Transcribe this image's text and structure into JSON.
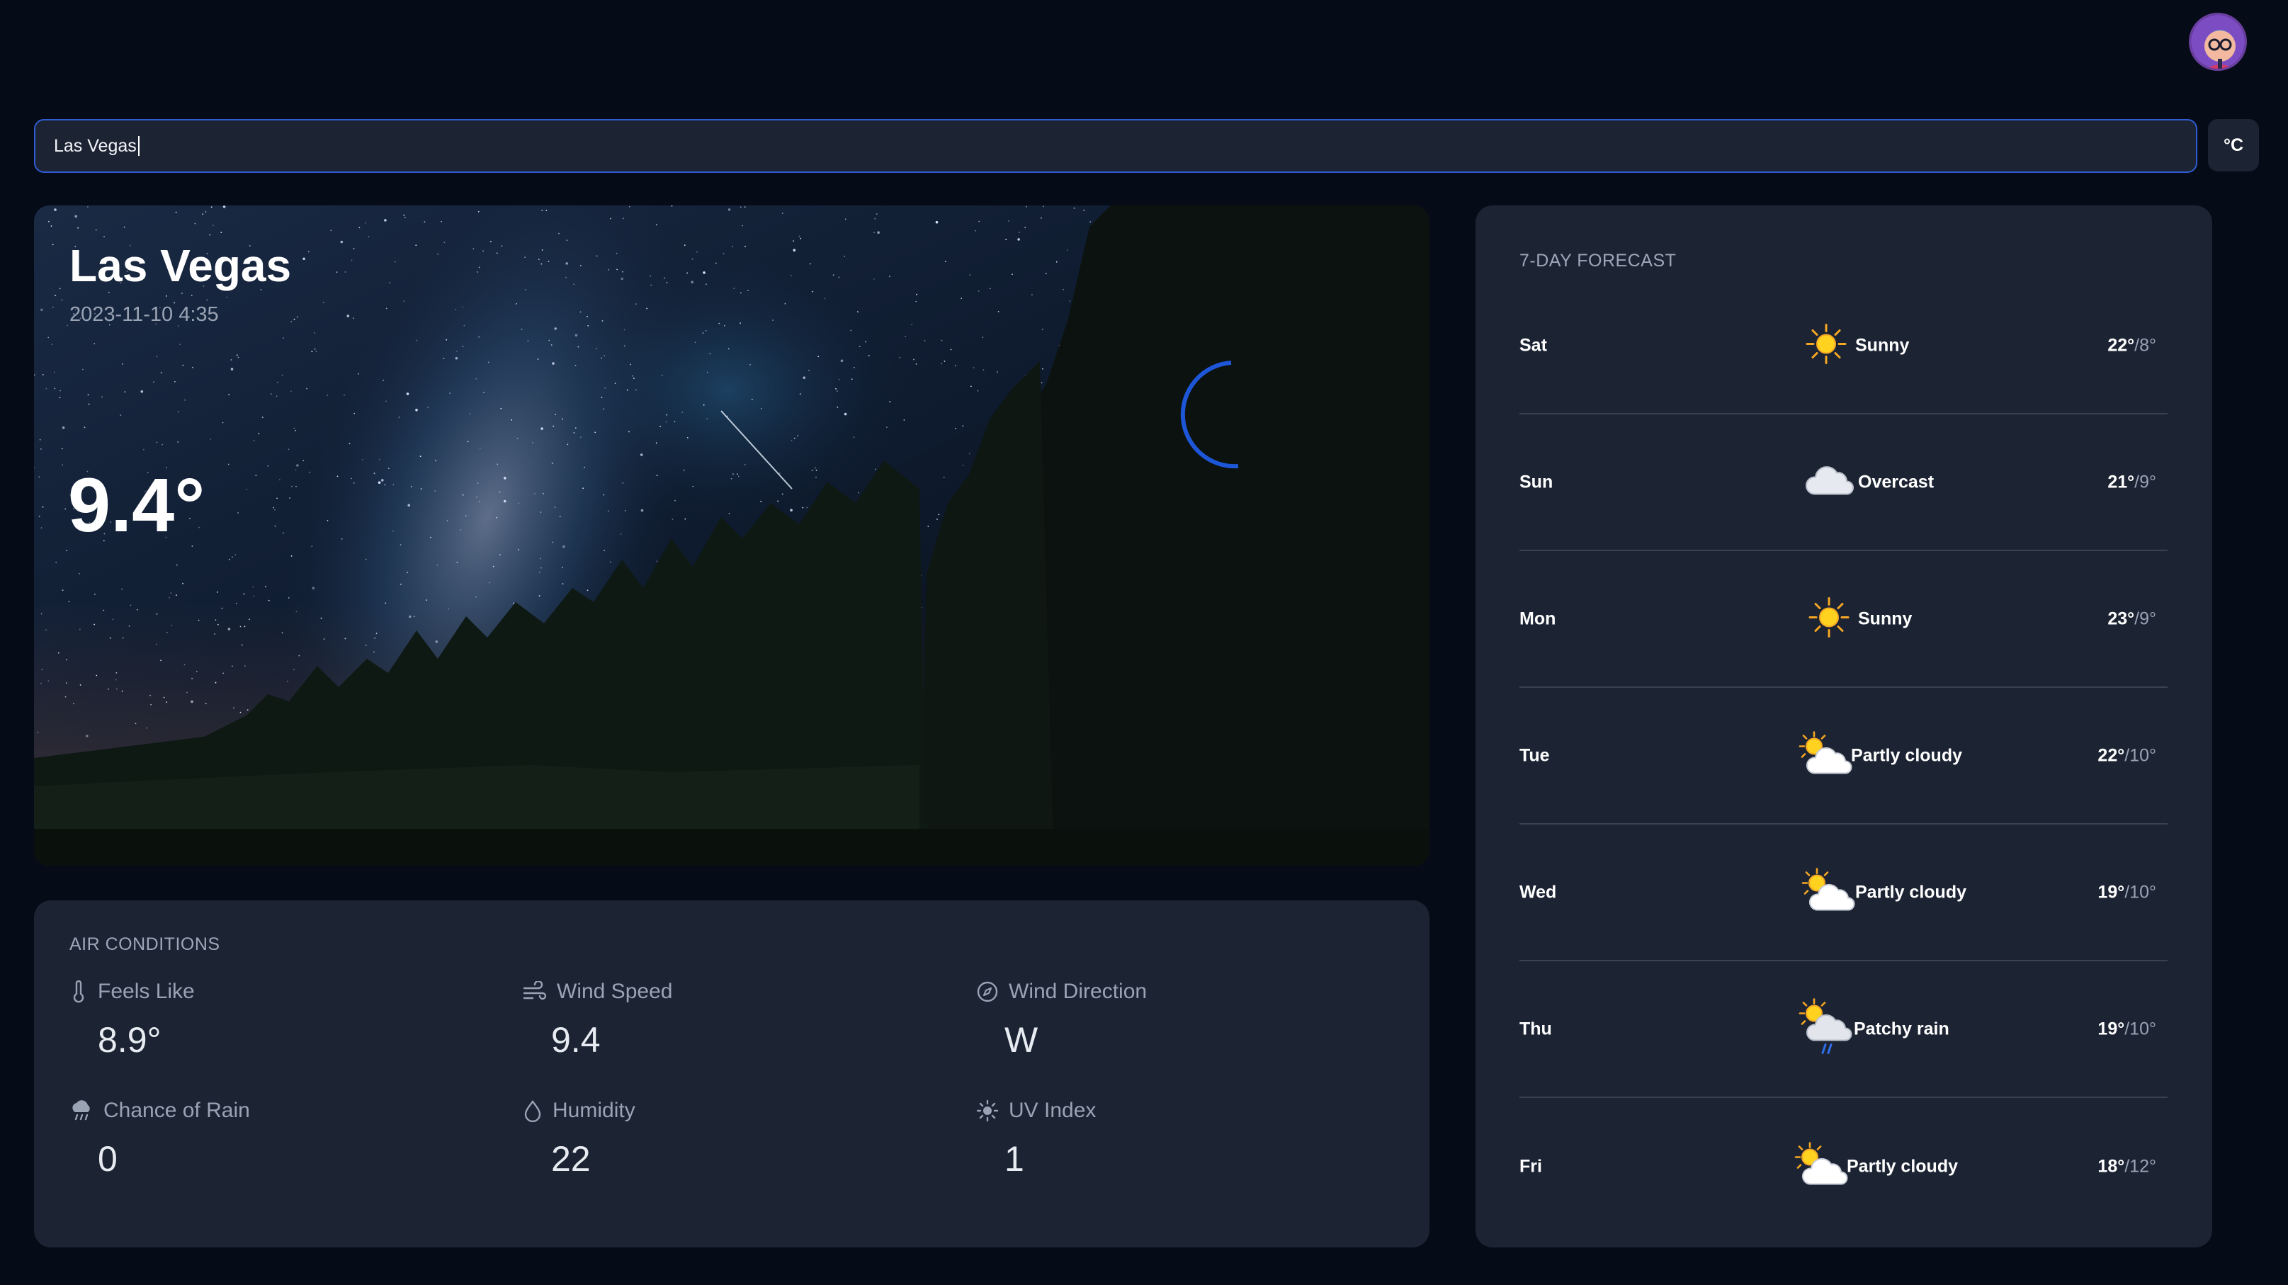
{
  "search": {
    "value": "Las Vegas"
  },
  "unit_toggle": {
    "label": "°C"
  },
  "current": {
    "city": "Las Vegas",
    "datetime": "2023-11-10 4:35",
    "temperature": "9.4°",
    "icon": "crescent-moon-icon"
  },
  "air_conditions": {
    "title": "AIR CONDITIONS",
    "metrics": [
      {
        "label": "Feels Like",
        "value": "8.9°",
        "icon": "thermometer-icon"
      },
      {
        "label": "Wind Speed",
        "value": "9.4",
        "icon": "wind-icon"
      },
      {
        "label": "Wind Direction",
        "value": "W",
        "icon": "compass-icon"
      },
      {
        "label": "Chance of Rain",
        "value": "0",
        "icon": "rain-cloud-icon"
      },
      {
        "label": "Humidity",
        "value": "22",
        "icon": "droplet-icon"
      },
      {
        "label": "UV Index",
        "value": "1",
        "icon": "sun-outline-icon"
      }
    ]
  },
  "forecast": {
    "title": "7-DAY FORECAST",
    "days": [
      {
        "day": "Sat",
        "condition": "Sunny",
        "high": "22°",
        "low": "/8°",
        "icon": "sun-icon"
      },
      {
        "day": "Sun",
        "condition": "Overcast",
        "high": "21°",
        "low": "/9°",
        "icon": "cloud-icon"
      },
      {
        "day": "Mon",
        "condition": "Sunny",
        "high": "23°",
        "low": "/9°",
        "icon": "sun-icon"
      },
      {
        "day": "Tue",
        "condition": "Partly cloudy",
        "high": "22°",
        "low": "/10°",
        "icon": "partly-cloudy-icon"
      },
      {
        "day": "Wed",
        "condition": "Partly cloudy",
        "high": "19°",
        "low": "/10°",
        "icon": "partly-cloudy-icon"
      },
      {
        "day": "Thu",
        "condition": "Patchy rain",
        "high": "19°",
        "low": "/10°",
        "icon": "patchy-rain-icon"
      },
      {
        "day": "Fri",
        "condition": "Partly cloudy",
        "high": "18°",
        "low": "/12°",
        "icon": "partly-cloudy-icon"
      }
    ]
  },
  "colors": {
    "background": "#050c17",
    "card": "#1c2433",
    "search_border": "#2f5bd3",
    "muted_text": "#9aa3b4",
    "moon": "#3b7bff"
  }
}
